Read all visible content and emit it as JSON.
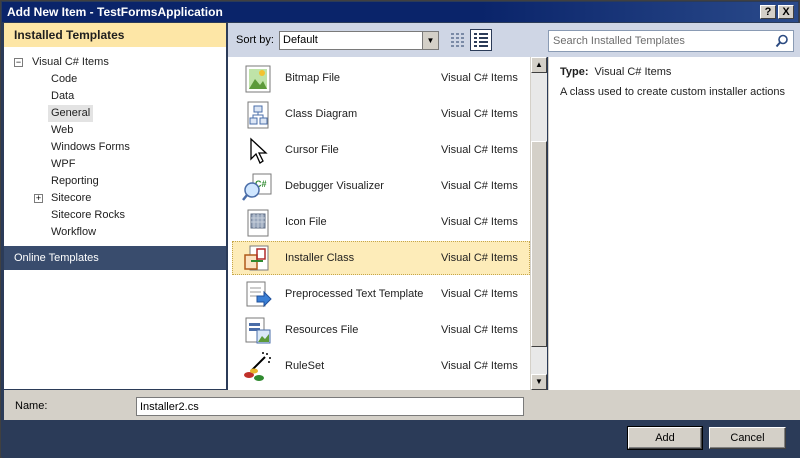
{
  "window": {
    "title": "Add New Item - TestFormsApplication",
    "help_glyph": "?",
    "close_glyph": "X"
  },
  "left": {
    "installed_header": "Installed Templates",
    "tree": [
      {
        "label": "Visual C# Items",
        "expander": "−"
      },
      {
        "label": "Code"
      },
      {
        "label": "Data"
      },
      {
        "label": "General",
        "selected": true
      },
      {
        "label": "Web"
      },
      {
        "label": "Windows Forms"
      },
      {
        "label": "WPF"
      },
      {
        "label": "Reporting"
      },
      {
        "label": "Sitecore",
        "expander": "+"
      },
      {
        "label": "Sitecore Rocks"
      },
      {
        "label": "Workflow"
      }
    ],
    "online_templates": "Online Templates"
  },
  "toolbar": {
    "sort_label": "Sort by:",
    "sort_value": "Default",
    "search_placeholder": "Search Installed Templates",
    "icons": [
      "small-icons-view-icon",
      "list-view-icon",
      "search-icon"
    ]
  },
  "templates": [
    {
      "name": "Bitmap File",
      "type": "Visual C# Items",
      "icon": "bitmap-file-icon"
    },
    {
      "name": "Class Diagram",
      "type": "Visual C# Items",
      "icon": "class-diagram-icon"
    },
    {
      "name": "Cursor File",
      "type": "Visual C# Items",
      "icon": "cursor-file-icon"
    },
    {
      "name": "Debugger Visualizer",
      "type": "Visual C# Items",
      "icon": "debugger-visualizer-icon"
    },
    {
      "name": "Icon File",
      "type": "Visual C# Items",
      "icon": "icon-file-icon"
    },
    {
      "name": "Installer Class",
      "type": "Visual C# Items",
      "icon": "installer-class-icon",
      "selected": true
    },
    {
      "name": "Preprocessed Text Template",
      "type": "Visual C# Items",
      "icon": "preprocessed-text-template-icon"
    },
    {
      "name": "Resources File",
      "type": "Visual C# Items",
      "icon": "resources-file-icon"
    },
    {
      "name": "RuleSet",
      "type": "Visual C# Items",
      "icon": "ruleset-icon"
    }
  ],
  "details": {
    "type_label": "Type:",
    "type_value": "Visual C# Items",
    "description": "A class used to create custom installer actions"
  },
  "name_field": {
    "label": "Name:",
    "value": "Installer2.cs"
  },
  "buttons": {
    "add": "Add",
    "cancel": "Cancel"
  },
  "colors": {
    "selected_row": "#fdecb9",
    "header_band": "#fde6a6",
    "online_band": "#394c6d",
    "frame": "#2b3b58",
    "title_bar": "#0a246a"
  }
}
